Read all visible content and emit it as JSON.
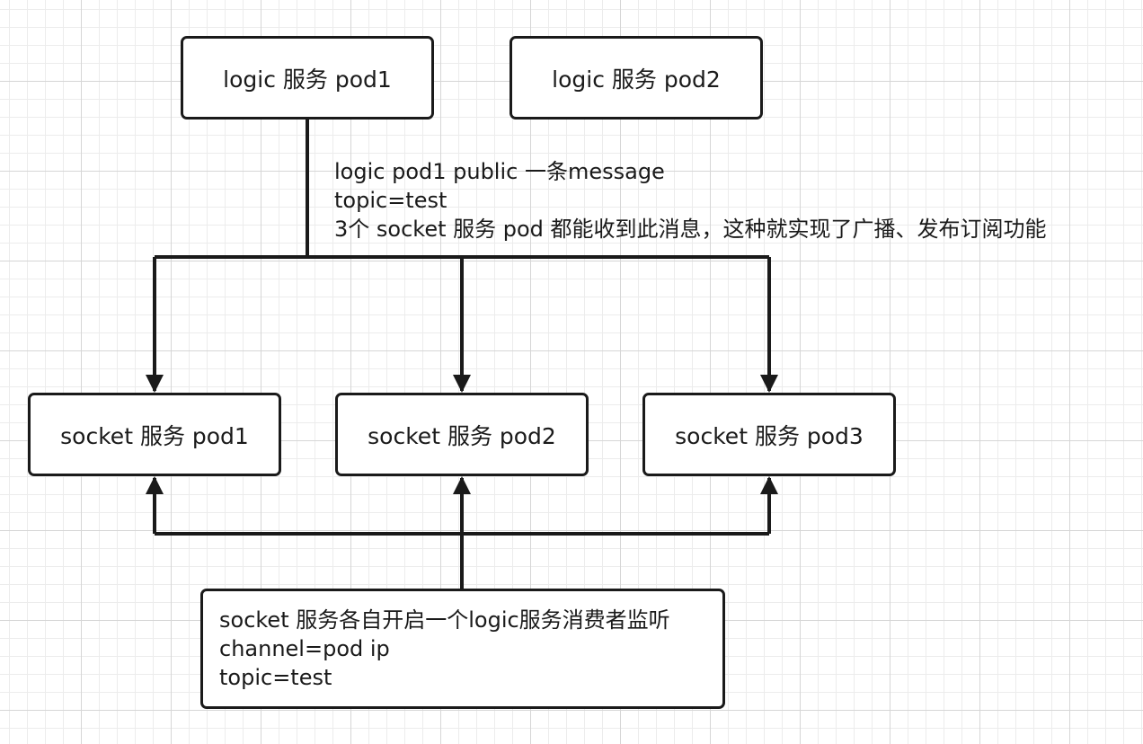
{
  "logic_pods": [
    {
      "label": "logic 服务 pod1"
    },
    {
      "label": "logic 服务 pod2"
    }
  ],
  "publish_note": {
    "line1": "logic pod1 public 一条message",
    "line2": "topic=test",
    "line3": "3个 socket 服务 pod 都能收到此消息，这种就实现了广播、发布订阅功能"
  },
  "socket_pods": [
    {
      "label": "socket 服务 pod1"
    },
    {
      "label": "socket 服务 pod2"
    },
    {
      "label": "socket 服务 pod3"
    }
  ],
  "consumer_note": {
    "line1": "socket 服务各自开启一个logic服务消费者监听",
    "line2": "channel=pod ip",
    "line3": "topic=test"
  },
  "colors": {
    "stroke": "#1a1a1a",
    "grid_major": "#d6d6d6",
    "grid_minor": "#ececec",
    "background": "#ffffff"
  }
}
